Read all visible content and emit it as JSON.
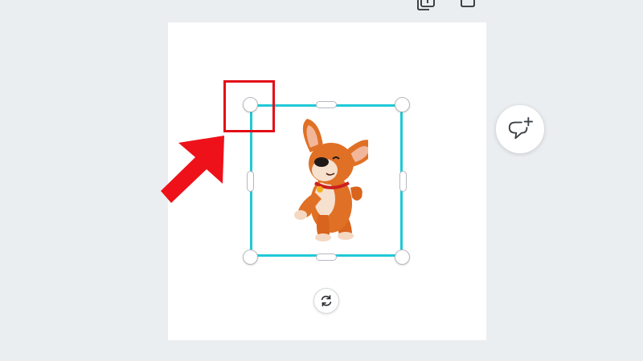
{
  "toolbar": {
    "icons": [
      "duplicate-page-icon",
      "add-page-icon"
    ]
  },
  "canvas": {
    "background": "#ebeef1",
    "page_color": "#ffffff"
  },
  "selection": {
    "border_color": "#1fc9d7",
    "element": "corgi-puppy-sticker"
  },
  "annotation": {
    "highlight_color": "#e30e17",
    "target": "top-left-resize-handle"
  },
  "controls": {
    "rotate_icon": "rotate-arrows-icon",
    "comment_icon": "add-comment-icon"
  }
}
